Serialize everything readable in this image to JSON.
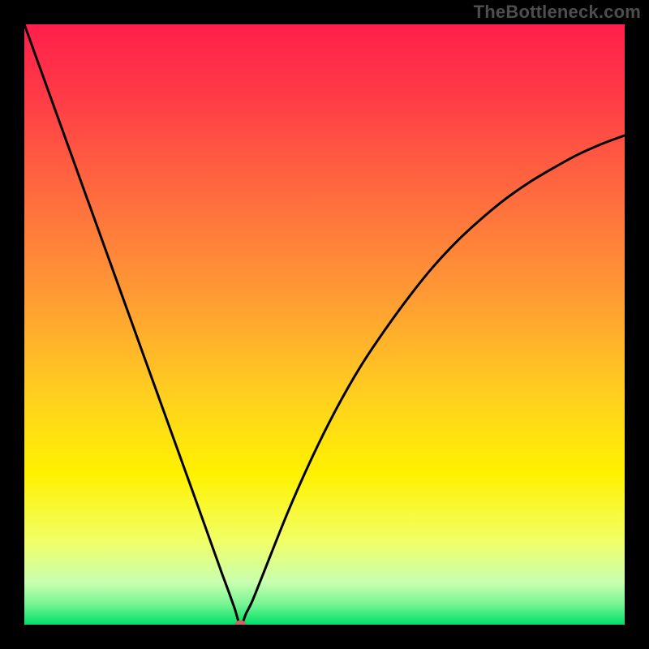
{
  "watermark": "TheBottleneck.com",
  "chart_data": {
    "type": "line",
    "title": "",
    "xlabel": "",
    "ylabel": "",
    "x_range": [
      0,
      100
    ],
    "y_range": [
      0,
      100
    ],
    "marker": {
      "x": 36,
      "y": 0,
      "color": "#c76a5b"
    },
    "series": [
      {
        "name": "curve",
        "x": [
          0,
          4,
          8,
          12,
          16,
          20,
          24,
          28,
          30,
          32,
          33,
          34,
          35,
          36,
          37,
          38,
          40,
          44,
          48,
          52,
          56,
          60,
          64,
          68,
          72,
          76,
          80,
          84,
          88,
          92,
          96,
          100
        ],
        "y": [
          100,
          88.9,
          77.8,
          66.7,
          55.6,
          44.5,
          33.4,
          22.3,
          16.7,
          11.1,
          8.3,
          5.6,
          2.8,
          0.0,
          2.0,
          4.0,
          9.0,
          19.0,
          28.0,
          36.0,
          43.0,
          49.0,
          54.5,
          59.5,
          63.8,
          67.5,
          70.8,
          73.6,
          76.0,
          78.2,
          80.0,
          81.5
        ]
      }
    ],
    "background_gradient": {
      "stops": [
        {
          "offset": 0.0,
          "color": "#ff1f4b"
        },
        {
          "offset": 0.12,
          "color": "#ff3b47"
        },
        {
          "offset": 0.28,
          "color": "#ff6a3f"
        },
        {
          "offset": 0.45,
          "color": "#ff9a34"
        },
        {
          "offset": 0.62,
          "color": "#ffd01f"
        },
        {
          "offset": 0.75,
          "color": "#fff200"
        },
        {
          "offset": 0.86,
          "color": "#f2ff66"
        },
        {
          "offset": 0.93,
          "color": "#c8ffb0"
        },
        {
          "offset": 0.965,
          "color": "#7af593"
        },
        {
          "offset": 1.0,
          "color": "#00e06a"
        }
      ]
    }
  }
}
